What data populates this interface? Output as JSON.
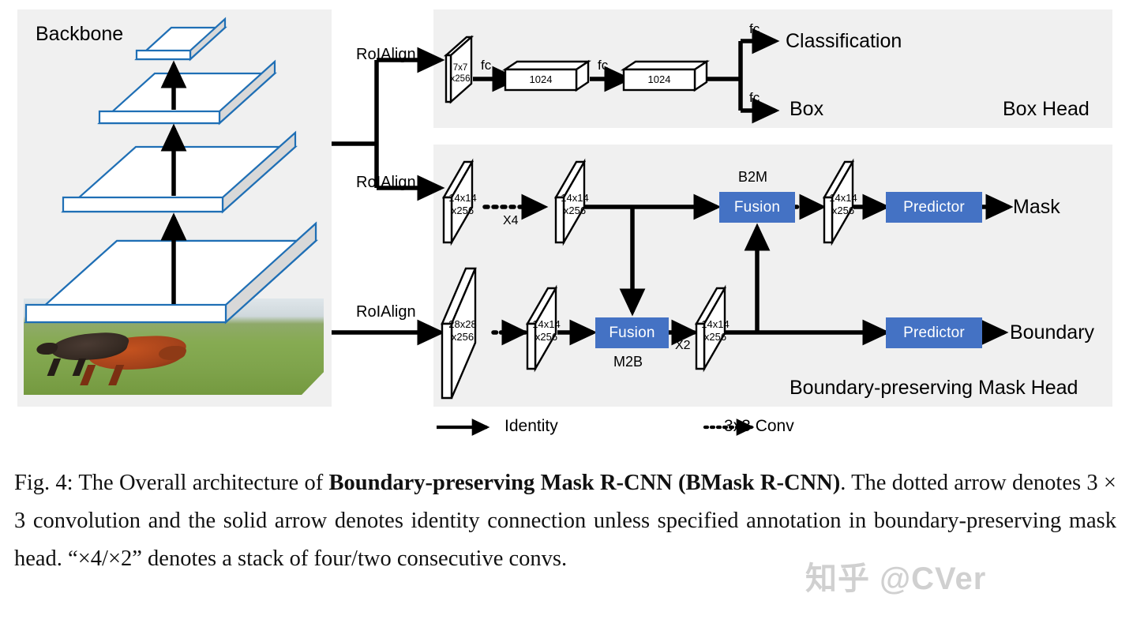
{
  "figure": {
    "backbone": {
      "title": "Backbone"
    },
    "roi": {
      "a": "RoIAlign",
      "b": "RoIAlign",
      "c": "RoIAlign"
    },
    "box_head": {
      "title": "Box Head",
      "input_map": {
        "size": "7x7",
        "channels": "x256"
      },
      "fc1_label": "fc",
      "fc1_box": "1024",
      "fc2_label": "fc",
      "fc2_box": "1024",
      "branch_cls_label": "fc",
      "branch_cls_out": "Classification",
      "branch_box_label": "fc",
      "branch_box_out": "Box"
    },
    "mask_head": {
      "title": "Boundary-preserving Mask Head",
      "mask_branch": {
        "map1": {
          "size": "14x14",
          "channels": "x256"
        },
        "stack_label": "X4",
        "map2": {
          "size": "14x14",
          "channels": "x256"
        },
        "fusion_tag": "B2M",
        "fusion_label": "Fusion",
        "map3": {
          "size": "14x14",
          "channels": "x256"
        },
        "predictor_label": "Predictor",
        "output": "Mask"
      },
      "boundary_branch": {
        "map1": {
          "size": "28x28",
          "channels": "x256"
        },
        "map2": {
          "size": "14x14",
          "channels": "x256"
        },
        "fusion_label": "Fusion",
        "fusion_tag": "M2B",
        "stack_label": "X2",
        "map3": {
          "size": "14x14",
          "channels": "x256"
        },
        "predictor_label": "Predictor",
        "output": "Boundary"
      }
    },
    "legend": {
      "identity": "Identity",
      "conv": "3x3 Conv"
    },
    "colors": {
      "panel_bg": "#f0f0f0",
      "block_blue": "#4472c4",
      "backbone_outline": "#1f6fb5",
      "stroke": "#000000"
    }
  },
  "caption": {
    "p1": "Fig. 4: The Overall architecture of ",
    "b1": "Boundary-preserving Mask R-CNN (BMask R-CNN)",
    "p2": ". The dotted arrow denotes 3 × 3 convolution and the solid arrow denotes identity connection unless specified annotation in boundary-preserving mask head. “×4/×2” denotes a stack of four/two consecutive convs."
  },
  "watermark": {
    "text": "知乎 @CVer"
  }
}
